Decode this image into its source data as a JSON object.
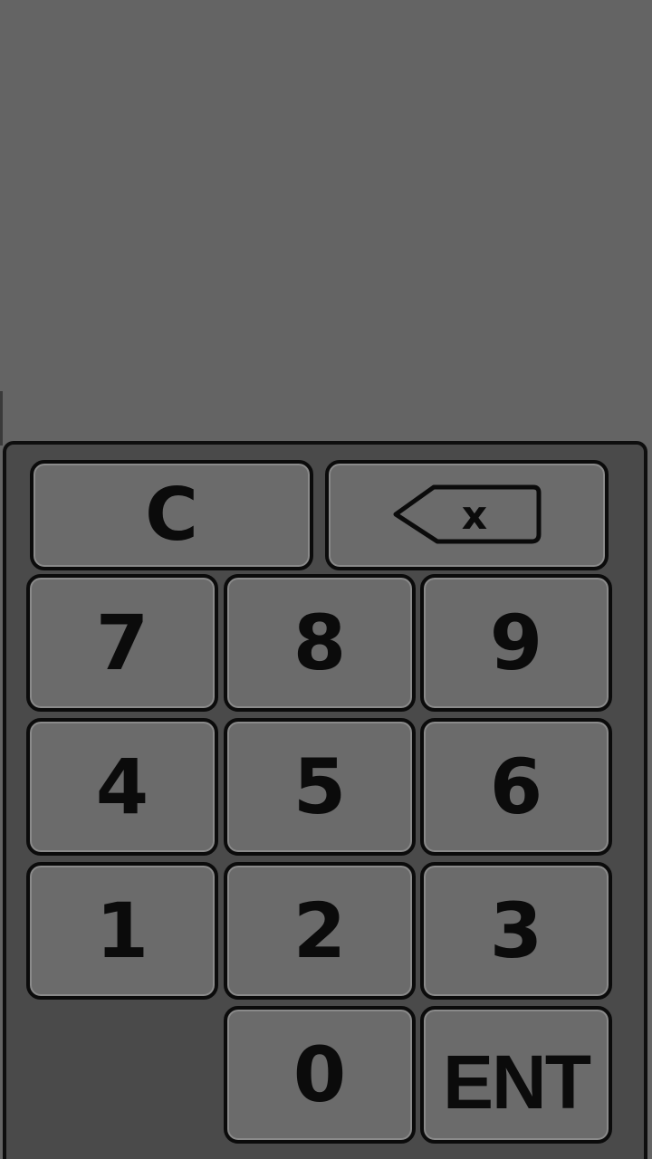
{
  "keypad": {
    "clear_label": "C",
    "backspace_icon": "backspace-x-icon",
    "backspace_glyph": "x",
    "keys": {
      "seven": "7",
      "eight": "8",
      "nine": "9",
      "four": "4",
      "five": "5",
      "six": "6",
      "one": "1",
      "two": "2",
      "three": "3",
      "zero": "0",
      "enter": "ENT"
    }
  },
  "colors": {
    "background": "#646464",
    "panel": "#4a4a4a",
    "key": "#6b6b6b",
    "outline": "#0b0b0b"
  }
}
